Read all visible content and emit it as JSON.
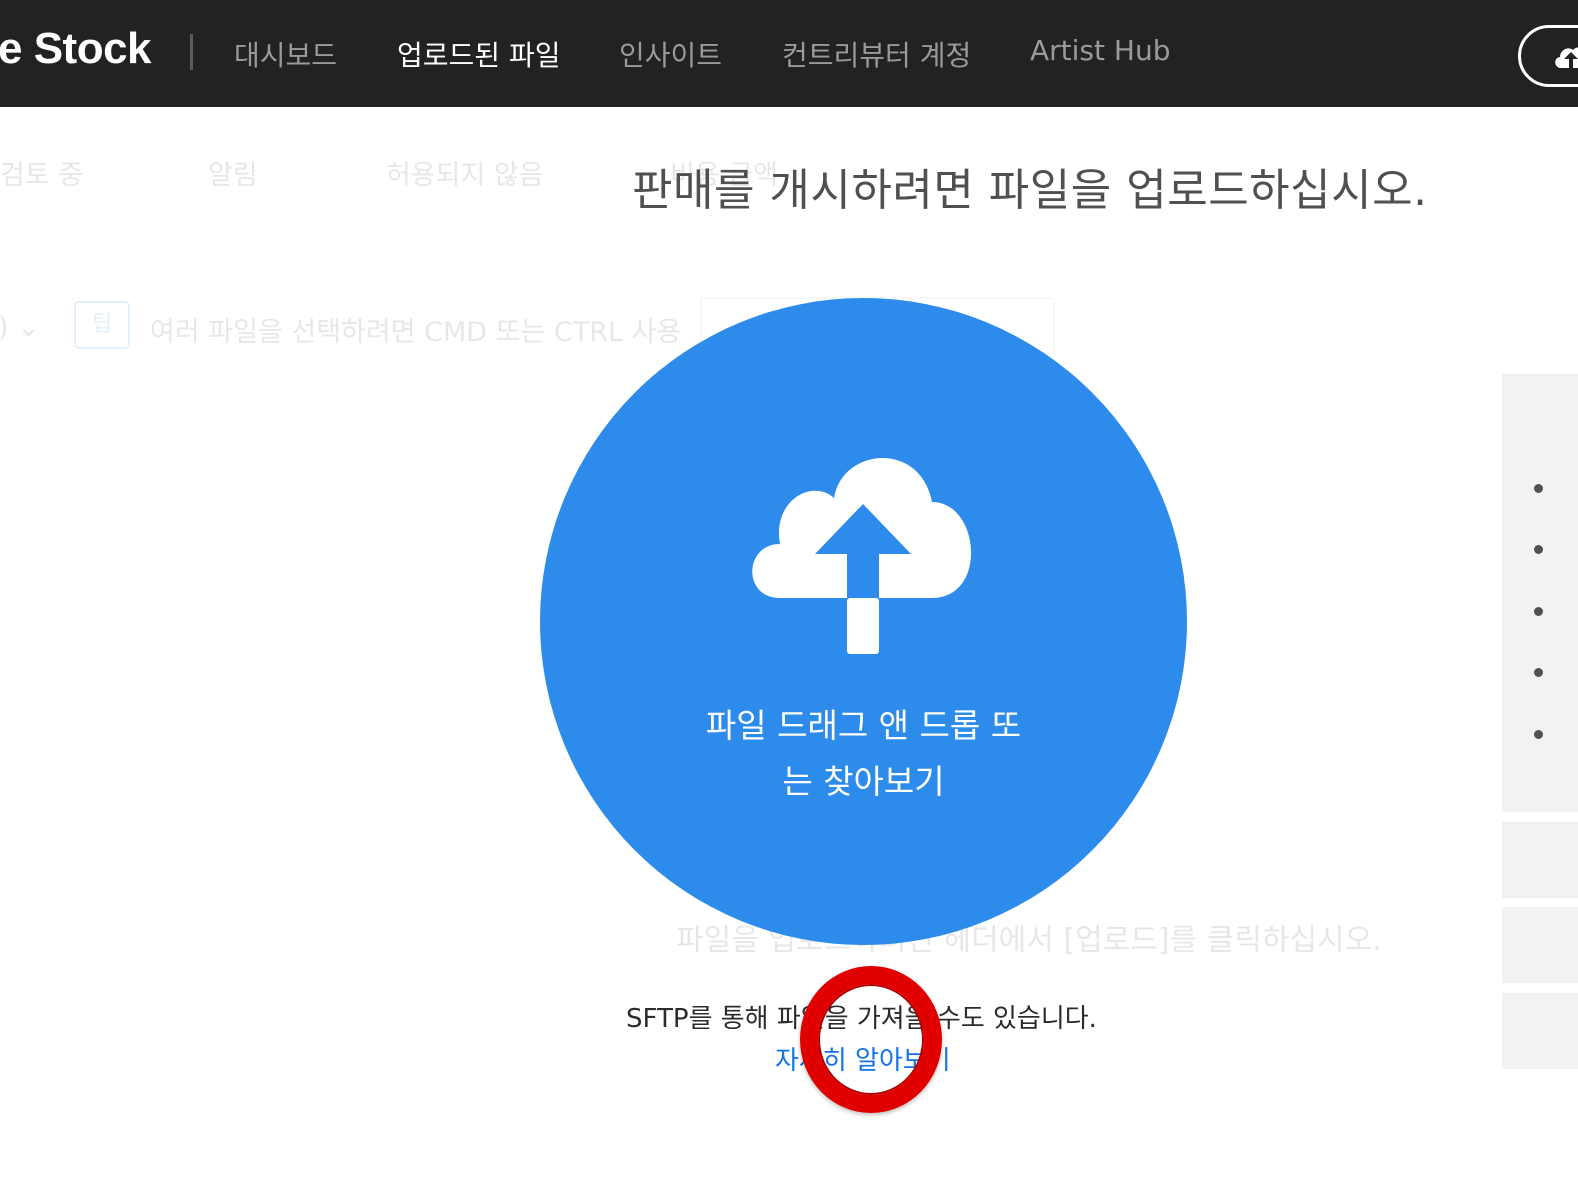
{
  "header": {
    "brand": "e Stock",
    "nav": [
      {
        "label": "대시보드",
        "active": false
      },
      {
        "label": "업로드된 파일",
        "active": true
      },
      {
        "label": "인사이트",
        "active": false
      },
      {
        "label": "컨트리뷰터 계정",
        "active": false
      },
      {
        "label": "Artist Hub",
        "active": false
      }
    ],
    "upload_icon": "cloud-upload-icon"
  },
  "background": {
    "tabs": [
      "검토 중",
      "알림",
      "허용되지 않음",
      "비용 금액"
    ],
    "dropdown_label": ")",
    "tip_badge": "팁",
    "tip_text": "여러 파일을 선택하려면 CMD 또는 CTRL 사용",
    "hint_text": "파일을 업로드하려면 헤더에서 [업로드]를 클릭하십시오."
  },
  "main": {
    "headline": "판매를 개시하려면 파일을 업로드하십시오.",
    "dropzone": {
      "line1": "파일 드래그 앤 드롭 또",
      "line2": "는 찾아보기",
      "icon": "cloud-upload-icon"
    },
    "sftp_text": "SFTP를 통해 파일을 가져올 수도 있습니다.",
    "learn_more": "자세히 알아보기"
  },
  "colors": {
    "topbar": "#222222",
    "accent": "#2d8ceb",
    "link": "#1473e6",
    "annotation": "#e00000"
  }
}
